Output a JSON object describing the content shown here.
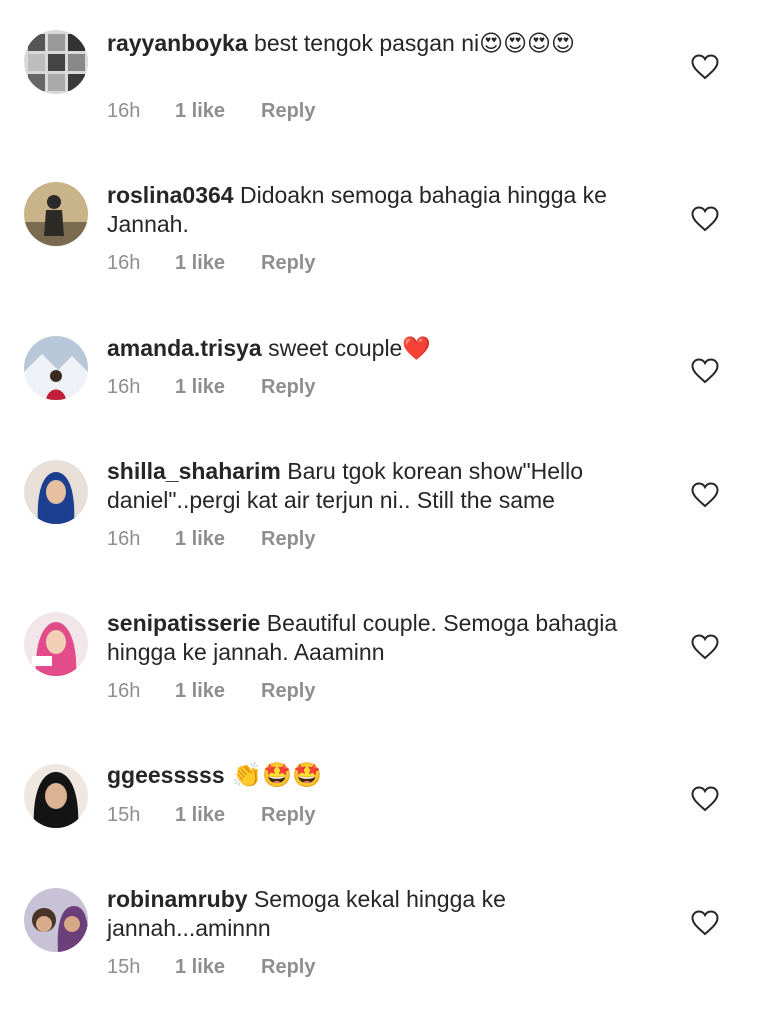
{
  "comments": [
    {
      "username": "rayyanboyka",
      "text": " best tengok pasgan ni😍😍😍😍",
      "time": "16h",
      "likes": "1 like",
      "reply": "Reply",
      "avatar": "grid-collage"
    },
    {
      "username": "roslina0364",
      "text": " Didoakn semoga bahagia hingga ke Jannah.",
      "time": "16h",
      "likes": "1 like",
      "reply": "Reply",
      "avatar": "person-standing"
    },
    {
      "username": "amanda.trisya",
      "text": " sweet couple❤️",
      "time": "16h",
      "likes": "1 like",
      "reply": "Reply",
      "avatar": "snow-landscape"
    },
    {
      "username": "shilla_shaharim",
      "text": " Baru tgok korean show\"Hello daniel\"..pergi kat air terjun ni.. Still the same",
      "time": "16h",
      "likes": "1 like",
      "reply": "Reply",
      "avatar": "hijab-blue"
    },
    {
      "username": "senipatisserie",
      "text": " Beautiful couple. Semoga bahagia hingga ke jannah. Aaaminn",
      "time": "16h",
      "likes": "1 like",
      "reply": "Reply",
      "avatar": "hijab-pink"
    },
    {
      "username": "ggeesssss",
      "text": " 👏🤩🤩",
      "time": "15h",
      "likes": "1 like",
      "reply": "Reply",
      "avatar": "woman-dark"
    },
    {
      "username": "robinamruby",
      "text": " Semoga kekal hingga ke jannah...aminnn",
      "time": "15h",
      "likes": "1 like",
      "reply": "Reply",
      "avatar": "two-children"
    }
  ],
  "colors": {
    "text": "#262626",
    "meta": "#8e8e8e",
    "heart_outline": "#262626"
  },
  "icons": {
    "like": "heart-outline-icon"
  }
}
